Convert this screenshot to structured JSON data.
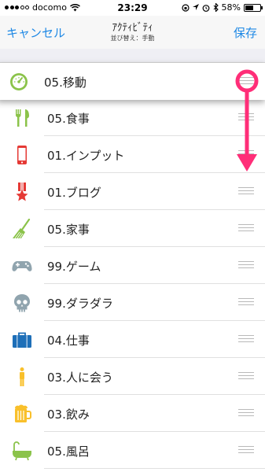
{
  "status_bar": {
    "carrier": "docomo",
    "time": "23:29",
    "battery": "58%",
    "battery_level": 0.58
  },
  "nav": {
    "cancel_label": "キャンセル",
    "title": "ｱｸﾃｨﾋﾞﾃｨ",
    "subtitle": "並び替え：手動",
    "save_label": "保存"
  },
  "list": {
    "items": [
      {
        "label": "05.移動",
        "icon": "speedometer-icon",
        "color": "#8bc34a"
      },
      {
        "label": "05.食事",
        "icon": "fork-knife-icon",
        "color": "#8bc34a"
      },
      {
        "label": "01.インプット",
        "icon": "smartphone-icon",
        "color": "#e53935"
      },
      {
        "label": "01.ブログ",
        "icon": "medal-star-icon",
        "color": "#e53935"
      },
      {
        "label": "05.家事",
        "icon": "broom-icon",
        "color": "#8bc34a"
      },
      {
        "label": "99.ゲーム",
        "icon": "gamepad-icon",
        "color": "#90a4ae"
      },
      {
        "label": "99.ダラダラ",
        "icon": "skull-icon",
        "color": "#90a4ae"
      },
      {
        "label": "04.仕事",
        "icon": "briefcase-icon",
        "color": "#1e6fb8"
      },
      {
        "label": "03.人に会う",
        "icon": "person-icon",
        "color": "#f9c02b"
      },
      {
        "label": "03.飲み",
        "icon": "beer-mug-icon",
        "color": "#f9c02b"
      },
      {
        "label": "05.風呂",
        "icon": "bathtub-icon",
        "color": "#8bc34a"
      }
    ]
  },
  "annotation": {
    "color": "#ff2e78"
  }
}
